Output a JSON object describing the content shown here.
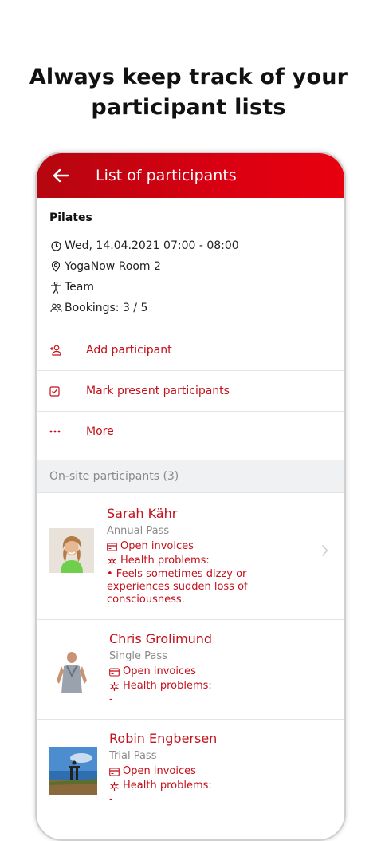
{
  "headline": {
    "line1": "Always keep track of your",
    "line2": "participant lists"
  },
  "appbar": {
    "title": "List of participants",
    "back_icon": "arrow-left-icon"
  },
  "course": {
    "name": "Pilates",
    "datetime": "Wed, 14.04.2021 07:00 - 08:00",
    "location": "YogaNow Room 2",
    "category": "Team",
    "bookings": "Bookings: 3 / 5"
  },
  "actions": [
    {
      "label": "Add participant",
      "icon": "add-person-icon"
    },
    {
      "label": "Mark present participants",
      "icon": "checkbox-icon"
    },
    {
      "label": "More",
      "icon": "more-dots-icon"
    }
  ],
  "section": {
    "title": "On-site participants (3)"
  },
  "participants": [
    {
      "name": "Sarah Kähr",
      "pass": "Annual Pass",
      "invoices": "Open invoices",
      "health_label": "Health problems:",
      "health_detail": "• Feels sometimes dizzy or experiences sudden loss of consciousness."
    },
    {
      "name": "Chris Grolimund",
      "pass": "Single Pass",
      "invoices": "Open invoices",
      "health_label": "Health problems:",
      "health_detail": "-"
    },
    {
      "name": "Robin Engbersen",
      "pass": "Trial Pass",
      "invoices": "Open invoices",
      "health_label": "Health problems:",
      "health_detail": "-"
    }
  ],
  "colors": {
    "brand_red": "#d90012",
    "accent_text": "#c50f1a"
  }
}
